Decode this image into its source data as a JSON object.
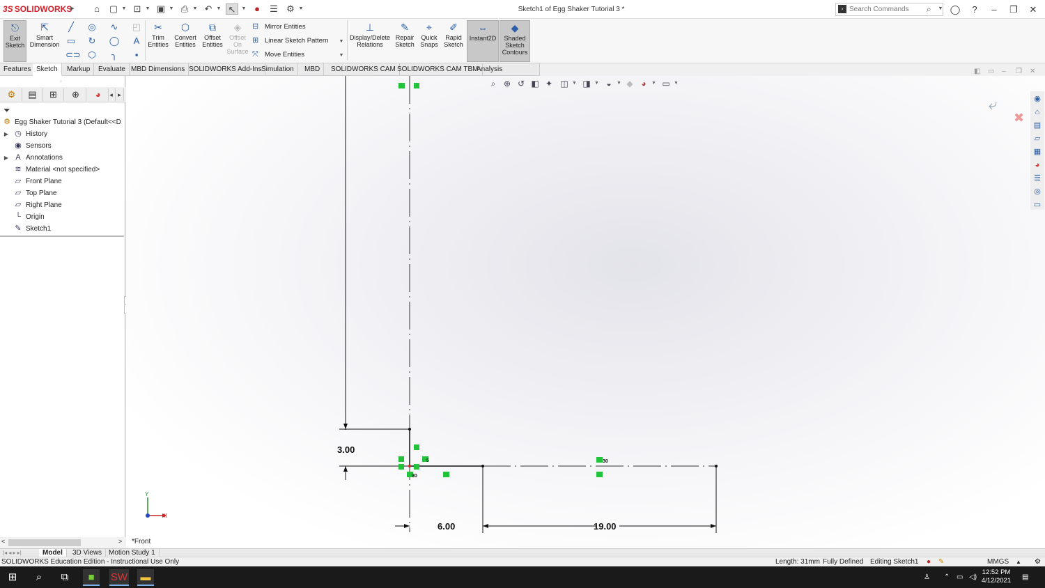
{
  "app": {
    "brand": "SOLIDWORKS",
    "brand_prefix": "3S",
    "document_title": "Sketch1 of Egg Shaker Tutorial 3 *",
    "search_placeholder": "Search Commands"
  },
  "commands": {
    "exit_sketch": "Exit Sketch",
    "smart_dimension": "Smart Dimension",
    "trim_entities": "Trim Entities",
    "convert_entities": "Convert Entities",
    "offset_entities": "Offset Entities",
    "offset_on_surface": "Offset On Surface",
    "mirror_entities": "Mirror Entities",
    "linear_sketch_pattern": "Linear Sketch Pattern",
    "move_entities": "Move Entities",
    "display_delete_relations": "Display/Delete Relations",
    "repair_sketch": "Repair Sketch",
    "quick_snaps": "Quick Snaps",
    "rapid_sketch": "Rapid Sketch",
    "instant2d": "Instant2D",
    "shaded_sketch_contours": "Shaded Sketch Contours"
  },
  "tabs": [
    "Features",
    "Sketch",
    "Markup",
    "Evaluate",
    "MBD Dimensions",
    "SOLIDWORKS Add-Ins",
    "Simulation",
    "MBD",
    "SOLIDWORKS CAM",
    "SOLIDWORKS CAM TBM",
    "Analysis Preparation"
  ],
  "active_tab": "Sketch",
  "tree": {
    "root": "Egg Shaker Tutorial 3  (Default<<D",
    "items": [
      {
        "label": "History",
        "icon": "history-icon",
        "expandable": true
      },
      {
        "label": "Sensors",
        "icon": "sensors-icon",
        "expandable": false
      },
      {
        "label": "Annotations",
        "icon": "annotations-icon",
        "expandable": true
      },
      {
        "label": "Material <not specified>",
        "icon": "material-icon",
        "expandable": false
      },
      {
        "label": "Front Plane",
        "icon": "plane-icon",
        "expandable": false
      },
      {
        "label": "Top Plane",
        "icon": "plane-icon",
        "expandable": false
      },
      {
        "label": "Right Plane",
        "icon": "plane-icon",
        "expandable": false
      },
      {
        "label": "Origin",
        "icon": "origin-icon",
        "expandable": false
      },
      {
        "label": "Sketch1",
        "icon": "sketch-icon",
        "expandable": false
      }
    ]
  },
  "sketch": {
    "dimensions": {
      "vertical": "3.00",
      "horizontal_left": "6.00",
      "horizontal_right": "19.00"
    },
    "relation_labels": [
      "5",
      "30",
      "30",
      "1"
    ],
    "axis_x": "X",
    "axis_y": "Y",
    "view_label": "*Front"
  },
  "bottom_tabs": [
    "Model",
    "3D Views",
    "Motion Study 1"
  ],
  "active_bottom_tab": "Model",
  "status": {
    "edition": "SOLIDWORKS Education Edition - Instructional Use Only",
    "length": "Length: 31mm",
    "definition": "Fully Defined",
    "editing": "Editing Sketch1",
    "units": "MMGS"
  },
  "taskbar": {
    "time": "12:52 PM",
    "date": "4/12/2021"
  },
  "colors": {
    "brand_red": "#d2232a",
    "relation_green": "#22c33a",
    "sketch_black": "#111111"
  }
}
